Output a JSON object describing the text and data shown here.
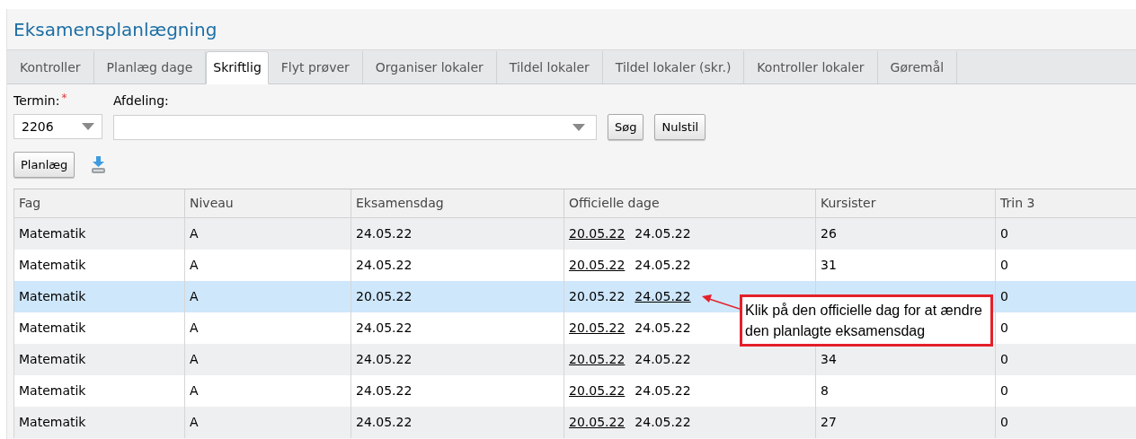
{
  "title": "Eksamensplanlægning",
  "tabs": [
    {
      "label": "Kontroller",
      "selected": false
    },
    {
      "label": "Planlæg dage",
      "selected": false
    },
    {
      "label": "Skriftlig",
      "selected": true
    },
    {
      "label": "Flyt prøver",
      "selected": false
    },
    {
      "label": "Organiser lokaler",
      "selected": false
    },
    {
      "label": "Tildel lokaler",
      "selected": false
    },
    {
      "label": "Tildel lokaler (skr.)",
      "selected": false
    },
    {
      "label": "Kontroller lokaler",
      "selected": false
    },
    {
      "label": "Gøremål",
      "selected": false
    }
  ],
  "filters": {
    "termin": {
      "label": "Termin:",
      "required_mark": "*",
      "value": "2206"
    },
    "afdeling": {
      "label": "Afdeling:"
    },
    "search_button": "Søg",
    "reset_button": "Nulstil"
  },
  "plan_button": "Planlæg",
  "table": {
    "columns": [
      "Fag",
      "Niveau",
      "Eksamensdag",
      "Officielle dage",
      "Kursister",
      "Trin 3"
    ],
    "rows": [
      {
        "selected": false,
        "fag": "Matematik",
        "niveau": "A",
        "eksamensdag": "24.05.22",
        "dates": [
          {
            "text": "20.05.22",
            "selected": false
          },
          {
            "text": "24.05.22",
            "selected": true
          }
        ],
        "kursister": "26",
        "trin3": "0"
      },
      {
        "selected": false,
        "fag": "Matematik",
        "niveau": "A",
        "eksamensdag": "24.05.22",
        "dates": [
          {
            "text": "20.05.22",
            "selected": false
          },
          {
            "text": "24.05.22",
            "selected": true
          }
        ],
        "kursister": "31",
        "trin3": "0"
      },
      {
        "selected": true,
        "fag": "Matematik",
        "niveau": "A",
        "eksamensdag": "20.05.22",
        "dates": [
          {
            "text": "20.05.22",
            "selected": true
          },
          {
            "text": "24.05.22",
            "selected": false
          }
        ],
        "trin3": "0"
      },
      {
        "selected": false,
        "fag": "Matematik",
        "niveau": "A",
        "eksamensdag": "24.05.22",
        "dates": [
          {
            "text": "20.05.22",
            "selected": false
          },
          {
            "text": "24.05.22",
            "selected": true
          }
        ],
        "trin3": "0"
      },
      {
        "selected": false,
        "fag": "Matematik",
        "niveau": "A",
        "eksamensdag": "24.05.22",
        "dates": [
          {
            "text": "20.05.22",
            "selected": false
          },
          {
            "text": "24.05.22",
            "selected": true
          }
        ],
        "kursister": "34",
        "trin3": "0"
      },
      {
        "selected": false,
        "fag": "Matematik",
        "niveau": "A",
        "eksamensdag": "24.05.22",
        "dates": [
          {
            "text": "20.05.22",
            "selected": false
          },
          {
            "text": "24.05.22",
            "selected": true
          }
        ],
        "kursister": "8",
        "trin3": "0"
      },
      {
        "selected": false,
        "fag": "Matematik",
        "niveau": "A",
        "eksamensdag": "24.05.22",
        "dates": [
          {
            "text": "20.05.22",
            "selected": false
          },
          {
            "text": "24.05.22",
            "selected": true
          }
        ],
        "kursister": "27",
        "trin3": "0"
      }
    ]
  },
  "callout": {
    "text": "Klik på den officielle dag for at ændre den planlagte eksamensdag"
  }
}
